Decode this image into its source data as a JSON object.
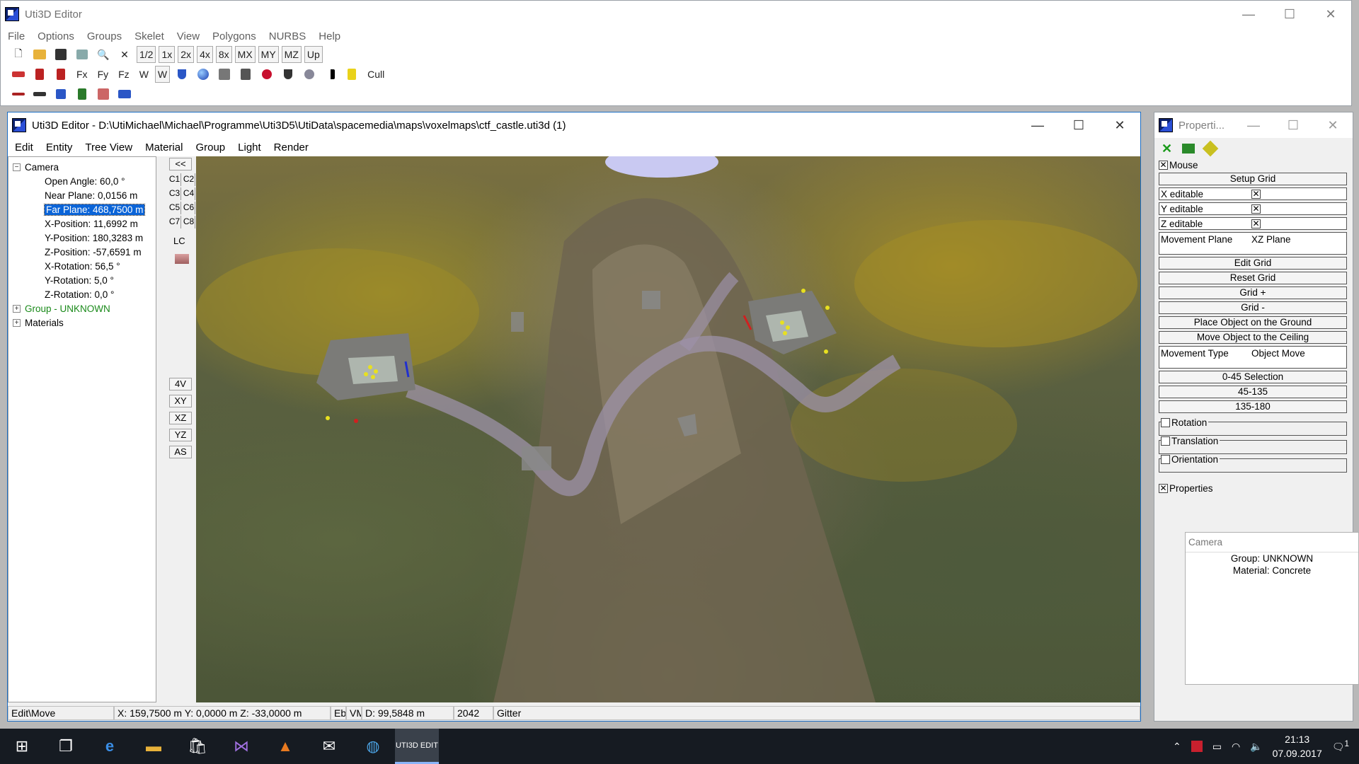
{
  "main_window": {
    "title": "Uti3D Editor",
    "menu": [
      "File",
      "Options",
      "Groups",
      "Skelet",
      "View",
      "Polygons",
      "NURBS",
      "Help"
    ],
    "toolbar1": [
      "new-file",
      "open-folder",
      "save",
      "properties",
      "zoom",
      "close-x",
      "1/2",
      "1x",
      "2x",
      "4x",
      "8x",
      "MX",
      "MY",
      "MZ",
      "Up"
    ],
    "toolbar2_labels": [
      "Fx",
      "Fy",
      "Fz",
      "W",
      "W",
      "Cull"
    ],
    "win_controls": {
      "min": "—",
      "max": "☐",
      "close": "✕"
    }
  },
  "editor_window": {
    "title": "Uti3D Editor - D:\\UtiMichael\\Michael\\Programme\\Uti3D5\\UtiData\\spacemedia\\maps\\voxelmaps\\ctf_castle.uti3d (1)",
    "menu": [
      "Edit",
      "Entity",
      "Tree View",
      "Material",
      "Group",
      "Light",
      "Render"
    ],
    "tree": {
      "camera_label": "Camera",
      "camera_children": [
        "Open Angle: 60,0 °",
        "Near Plane: 0,0156 m",
        "Far Plane: 468,7500 m",
        "X-Position: 11,6992 m",
        "Y-Position: 180,3283 m",
        "Z-Position: -57,6591 m",
        "X-Rotation: 56,5 °",
        "Y-Rotation: 5,0 °",
        "Z-Rotation: 0,0 °"
      ],
      "group_label": "Group - UNKNOWN",
      "materials_label": "Materials",
      "selected_index": 2
    },
    "side_tools": {
      "collapse": "<<",
      "cams": [
        "C1",
        "C2",
        "C3",
        "C4",
        "C5",
        "C6",
        "C7",
        "C8"
      ],
      "lc": "LC",
      "views": [
        "4V",
        "XY",
        "XZ",
        "YZ",
        "AS"
      ]
    },
    "status": {
      "mode": "Edit\\Move",
      "coords": "X: 159,7500 m Y: 0,0000 m Z: -33,0000 m",
      "eb": "Eb",
      "vm": "VM",
      "distance": "D: 99,5848 m",
      "count": "2042",
      "gitter": "Gitter"
    }
  },
  "properties_window": {
    "title": "Properti...",
    "mouse_group": "Mouse",
    "setup_grid": "Setup Grid",
    "x_editable": "X editable",
    "y_editable": "Y editable",
    "z_editable": "Z editable",
    "movement_plane_label": "Movement Plane",
    "movement_plane_value": "XZ Plane",
    "edit_grid": "Edit Grid",
    "reset_grid": "Reset Grid",
    "grid_plus": "Grid +",
    "grid_minus": "Grid -",
    "place_ground": "Place Object on the Ground",
    "move_ceiling": "Move Object to the Ceiling",
    "movement_type_label": "Movement Type",
    "movement_type_value": "Object Move",
    "sel_0_45": "0-45 Selection",
    "sel_45_135": "45-135",
    "sel_135_180": "135-180",
    "rotation": "Rotation",
    "translation": "Translation",
    "orientation": "Orientation",
    "properties": "Properties"
  },
  "camera_panel": {
    "title": "Camera",
    "group": "Group: UNKNOWN",
    "material": "Material: Concrete"
  },
  "taskbar": {
    "time": "21:13",
    "date": "07.09.2017",
    "uti_label": "UTI3D EDIT",
    "notification_count": "1"
  }
}
